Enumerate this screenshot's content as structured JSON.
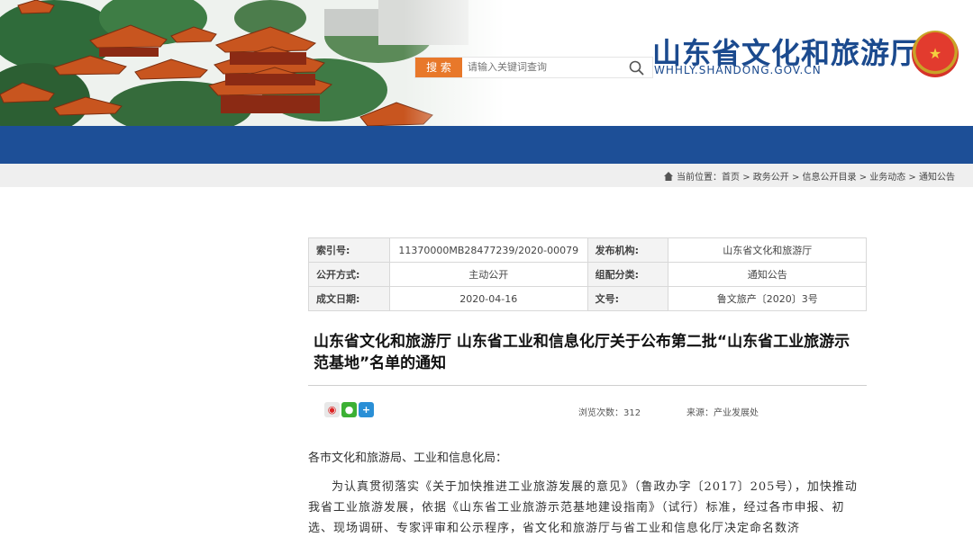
{
  "header": {
    "site_title": "山东省文化和旅游厅",
    "site_url": "WHHLY.SHANDONG.GOV.CN",
    "search_placeholder": "请输入关键词查询",
    "search_button": "搜 索"
  },
  "breadcrumb": {
    "text": "当前位置：首页 > 政务公开 > 信息公开目录 > 业务动态 > 通知公告"
  },
  "meta": {
    "index_label": "索引号:",
    "index_value": "11370000MB28477239/2020-00079",
    "issuer_label": "发布机构:",
    "issuer_value": "山东省文化和旅游厅",
    "method_label": "公开方式:",
    "method_value": "主动公开",
    "category_label": "组配分类:",
    "category_value": "通知公告",
    "date_label": "成文日期:",
    "date_value": "2020-04-16",
    "docno_label": "文号:",
    "docno_value": "鲁文旅产〔2020〕3号"
  },
  "article": {
    "title": "山东省文化和旅游厅 山东省工业和信息化厅关于公布第二批“山东省工业旅游示范基地”名单的通知",
    "views": "浏览次数：312",
    "source": "来源：产业发展处",
    "salutation": "各市文化和旅游局、工业和信息化局：",
    "paragraph": "为认真贯彻落实《关于加快推进工业旅游发展的意见》（鲁政办字〔2017〕205号），加快推动我省工业旅游发展，依据《山东省工业旅游示范基地建设指南》（试行）标准，经过各市申报、初选、现场调研、专家评审和公示程序，省文化和旅游厅与省工业和信息化厅决定命名数济"
  },
  "share": {
    "icons": [
      "weibo-icon",
      "wechat-icon",
      "plus-icon"
    ]
  },
  "colors": {
    "brand_blue": "#1d4f97",
    "title_blue": "#1b4a8e",
    "search_orange": "#e8782a"
  }
}
